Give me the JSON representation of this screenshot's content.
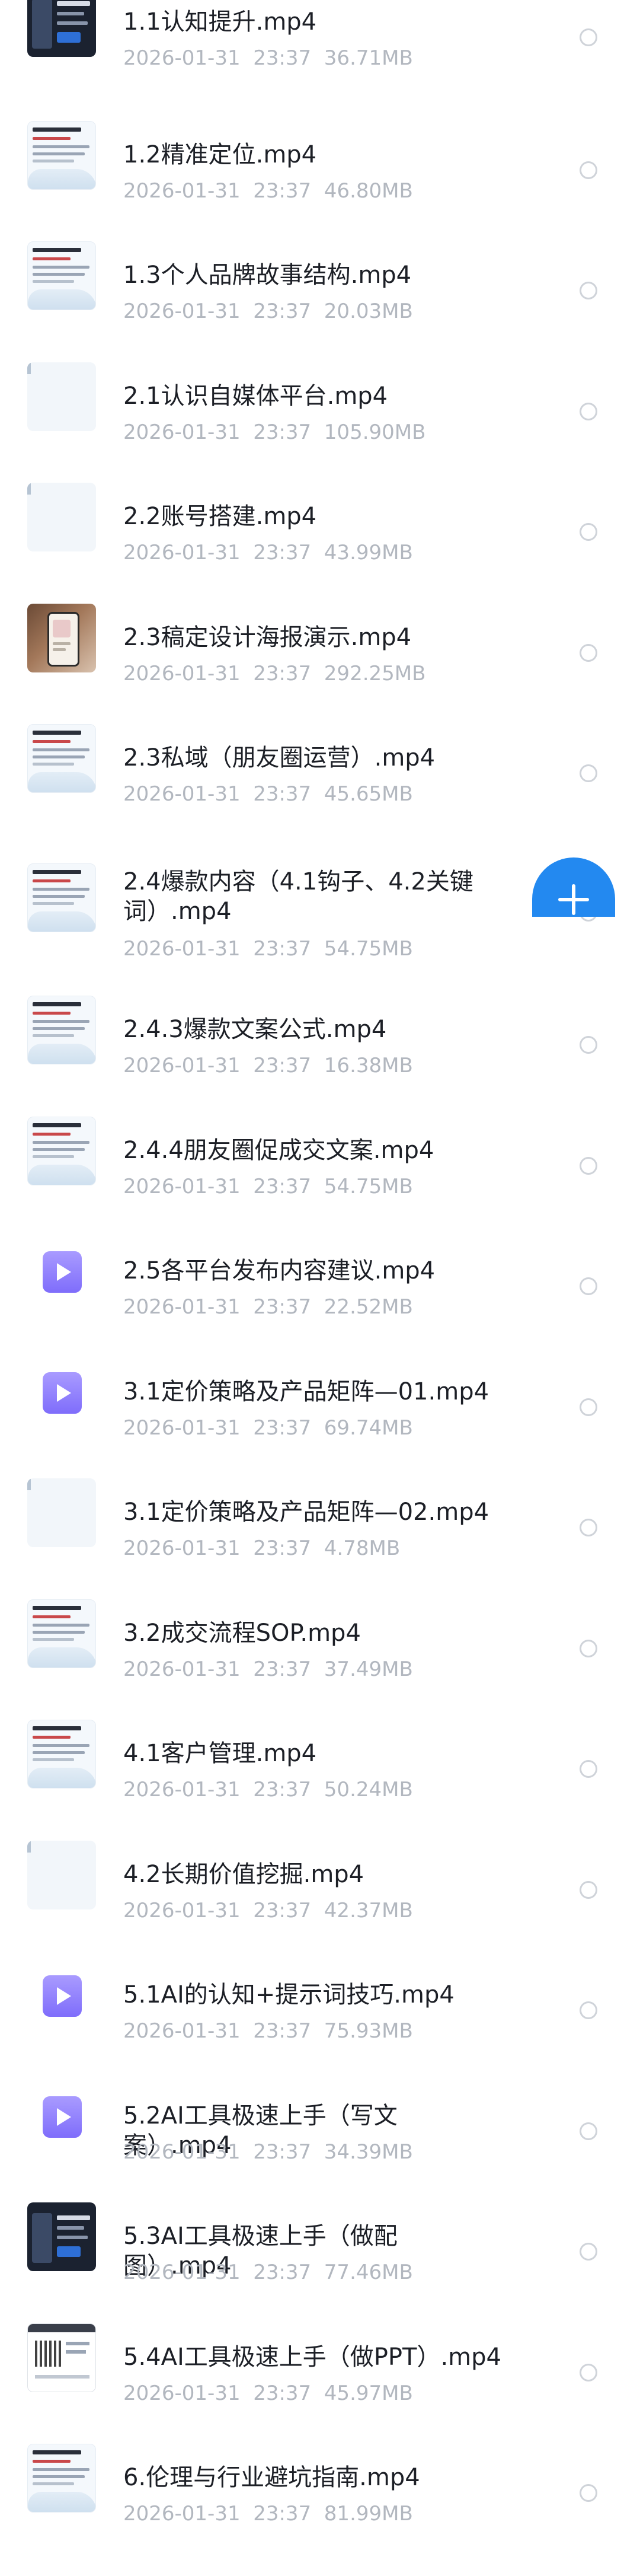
{
  "files": [
    {
      "name": "1.1认知提升.mp4",
      "date": "2026-01-31",
      "time": "23:37",
      "size": "36.71MB",
      "thumb": "dark"
    },
    {
      "name": "1.2精准定位.mp4",
      "date": "2026-01-31",
      "time": "23:37",
      "size": "46.80MB",
      "thumb": "doc"
    },
    {
      "name": "1.3个人品牌故事结构.mp4",
      "date": "2026-01-31",
      "time": "23:37",
      "size": "20.03MB",
      "thumb": "doc"
    },
    {
      "name": "2.1认识自媒体平台.mp4",
      "date": "2026-01-31",
      "time": "23:37",
      "size": "105.90MB",
      "thumb": "table"
    },
    {
      "name": "2.2账号搭建.mp4",
      "date": "2026-01-31",
      "time": "23:37",
      "size": "43.99MB",
      "thumb": "table"
    },
    {
      "name": "2.3稿定设计海报演示.mp4",
      "date": "2026-01-31",
      "time": "23:37",
      "size": "292.25MB",
      "thumb": "photo"
    },
    {
      "name": "2.3私域（朋友圈运营）.mp4",
      "date": "2026-01-31",
      "time": "23:37",
      "size": "45.65MB",
      "thumb": "doc"
    },
    {
      "name": "2.4爆款内容（4.1钩子、4.2关键\n词）.mp4",
      "date": "2026-01-31",
      "time": "23:37",
      "size": "54.75MB",
      "thumb": "doc"
    },
    {
      "name": "2.4.3爆款文案公式.mp4",
      "date": "2026-01-31",
      "time": "23:37",
      "size": "16.38MB",
      "thumb": "doc"
    },
    {
      "name": "2.4.4朋友圈促成交文案.mp4",
      "date": "2026-01-31",
      "time": "23:37",
      "size": "54.75MB",
      "thumb": "doc"
    },
    {
      "name": "2.5各平台发布内容建议.mp4",
      "date": "2026-01-31",
      "time": "23:37",
      "size": "22.52MB",
      "thumb": "video"
    },
    {
      "name": "3.1定价策略及产品矩阵—01.mp4",
      "date": "2026-01-31",
      "time": "23:37",
      "size": "69.74MB",
      "thumb": "video"
    },
    {
      "name": "3.1定价策略及产品矩阵—02.mp4",
      "date": "2026-01-31",
      "time": "23:37",
      "size": "4.78MB",
      "thumb": "table"
    },
    {
      "name": "3.2成交流程SOP.mp4",
      "date": "2026-01-31",
      "time": "23:37",
      "size": "37.49MB",
      "thumb": "doc"
    },
    {
      "name": "4.1客户管理.mp4",
      "date": "2026-01-31",
      "time": "23:37",
      "size": "50.24MB",
      "thumb": "doc"
    },
    {
      "name": "4.2长期价值挖掘.mp4",
      "date": "2026-01-31",
      "time": "23:37",
      "size": "42.37MB",
      "thumb": "table"
    },
    {
      "name": "5.1AI的认知+提示词技巧.mp4",
      "date": "2026-01-31",
      "time": "23:37",
      "size": "75.93MB",
      "thumb": "video"
    },
    {
      "name": "5.2AI工具极速上手（写文案）.mp4",
      "date": "2026-01-31",
      "time": "23:37",
      "size": "34.39MB",
      "thumb": "video"
    },
    {
      "name": "5.3AI工具极速上手（做配图）.mp4",
      "date": "2026-01-31",
      "time": "23:37",
      "size": "77.46MB",
      "thumb": "dark"
    },
    {
      "name": "5.4AI工具极速上手（做PPT）.mp4",
      "date": "2026-01-31",
      "time": "23:37",
      "size": "45.97MB",
      "thumb": "shot"
    },
    {
      "name": "6.伦理与行业避坑指南.mp4",
      "date": "2026-01-31",
      "time": "23:37",
      "size": "81.99MB",
      "thumb": "doc"
    }
  ],
  "colors": {
    "title": "#1c1f26",
    "meta": "#b2b7bf",
    "fab": "#2389f0",
    "radio_border": "#cfd3d9",
    "video_icon": "#8f7efc"
  },
  "icons": {
    "fab": "plus-icon",
    "video": "play-icon",
    "select": "radio-circle-icon"
  }
}
